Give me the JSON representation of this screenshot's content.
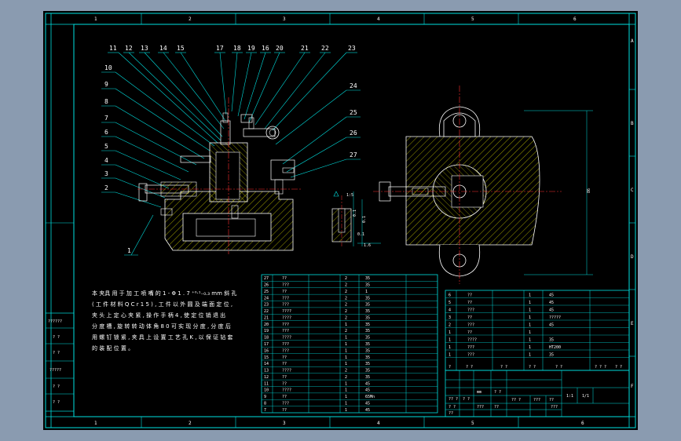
{
  "colors": {
    "frame": "#00e0e0",
    "outline": "#ffffff",
    "hatch": "#e0e000",
    "centerline": "#ff3030",
    "leader": "#00e0e0",
    "dimension": "#00e0e0",
    "table": "#00e0e0",
    "text": "#ffffff",
    "background": "#000000",
    "workspace": "#8a9bb0"
  },
  "border": {
    "top_zones": [
      "1",
      "2",
      "3",
      "4",
      "5",
      "6"
    ],
    "bottom_zones": [
      "1",
      "2",
      "3",
      "4",
      "5",
      "6"
    ],
    "right_zones": [
      "A",
      "B",
      "C",
      "D",
      "E",
      "F"
    ],
    "left_stamp": [
      "??????",
      "? ?",
      "? ?",
      "?????",
      "? ?",
      "? ?"
    ]
  },
  "leaders": [
    "1",
    "2",
    "3",
    "4",
    "5",
    "6",
    "7",
    "8",
    "9",
    "10",
    "11",
    "12",
    "13",
    "14",
    "15",
    "17",
    "18",
    "19",
    "16",
    "20",
    "21",
    "22",
    "23",
    "24",
    "25",
    "26",
    "27"
  ],
  "dimensions": {
    "section_label": "1:5",
    "side_height": "86",
    "hole_label": "Φ8",
    "tol_a": "0.1",
    "tol_b": "0.1",
    "tol_c": "0.1",
    "roughness": "1.6"
  },
  "technical_note": {
    "lines": [
      "本 夹具 用 于 加 工 喷 嘴 的 1 - Φ 1 . 7 ⁺⁰·¹₋₀.₃ mm 斜 孔",
      "( 工 件 材 料 Q C r 1 5 ) , 工 件 以 外 圆 及 端 面 定 位 ,",
      "夹 头 上 定 心 夹 紧 , 操 作 手 柄 4 , 使 定 位 销 退 出",
      "分 度 槽 , 旋 转 转 动 体 角 8 0 可 实 现 分 度 , 分 度 后",
      "用 螺 钉 锁 紧 , 夹 具 上 设 置 工 艺 孔 K , 以 保 证 钻 套",
      "的 装 配 位 置 。"
    ]
  },
  "parts_list_left": {
    "rows": [
      [
        "27",
        "??",
        "2",
        "35"
      ],
      [
        "26",
        "???",
        "2",
        "35"
      ],
      [
        "25",
        "??",
        "2",
        "1"
      ],
      [
        "24",
        "???",
        "2",
        "35"
      ],
      [
        "23",
        "???",
        "2",
        "35"
      ],
      [
        "22",
        "????",
        "2",
        "35"
      ],
      [
        "21",
        "????",
        "2",
        "35"
      ],
      [
        "20",
        "???",
        "1",
        "35"
      ],
      [
        "19",
        "???",
        "2",
        "35"
      ],
      [
        "18",
        "????",
        "1",
        "35"
      ],
      [
        "17",
        "???",
        "1",
        "35"
      ],
      [
        "16",
        "???",
        "1",
        "35"
      ],
      [
        "15",
        "??",
        "1",
        "35"
      ],
      [
        "14",
        "??",
        "1",
        "35"
      ],
      [
        "13",
        "????",
        "2",
        "35"
      ],
      [
        "12",
        "??",
        "2",
        "35"
      ],
      [
        "11",
        "??",
        "1",
        "45"
      ],
      [
        "10",
        "????",
        "1",
        "45"
      ],
      [
        "9",
        "??",
        "1",
        "65Mn"
      ],
      [
        "8",
        "???",
        "1",
        "45"
      ],
      [
        "7",
        "??",
        "1",
        "45"
      ]
    ]
  },
  "parts_list_right": {
    "rows": [
      [
        "6",
        "??",
        "1",
        "45"
      ],
      [
        "5",
        "??",
        "1",
        "45"
      ],
      [
        "4",
        "???",
        "1",
        "45"
      ],
      [
        "3",
        "??",
        "1",
        "?????"
      ],
      [
        "2",
        "???",
        "1",
        "45"
      ],
      [
        "1",
        "??",
        "1",
        ""
      ],
      [
        "1",
        "????",
        "1",
        "35"
      ],
      [
        "1",
        "???",
        "1",
        "HT200"
      ],
      [
        "1",
        "???",
        "1",
        "35"
      ]
    ],
    "header": [
      "?",
      "? ?",
      "? ?",
      "? ?",
      "? ?",
      "? ? ?",
      "? ?"
    ]
  },
  "title_block": {
    "scale": "1:1",
    "sheet": "1/1",
    "code": "???",
    "cells": [
      "?? ?",
      "? ?",
      "mm",
      "? ?",
      "? ?",
      "???",
      "??",
      "?? ?",
      "???",
      "??",
      "??"
    ]
  }
}
